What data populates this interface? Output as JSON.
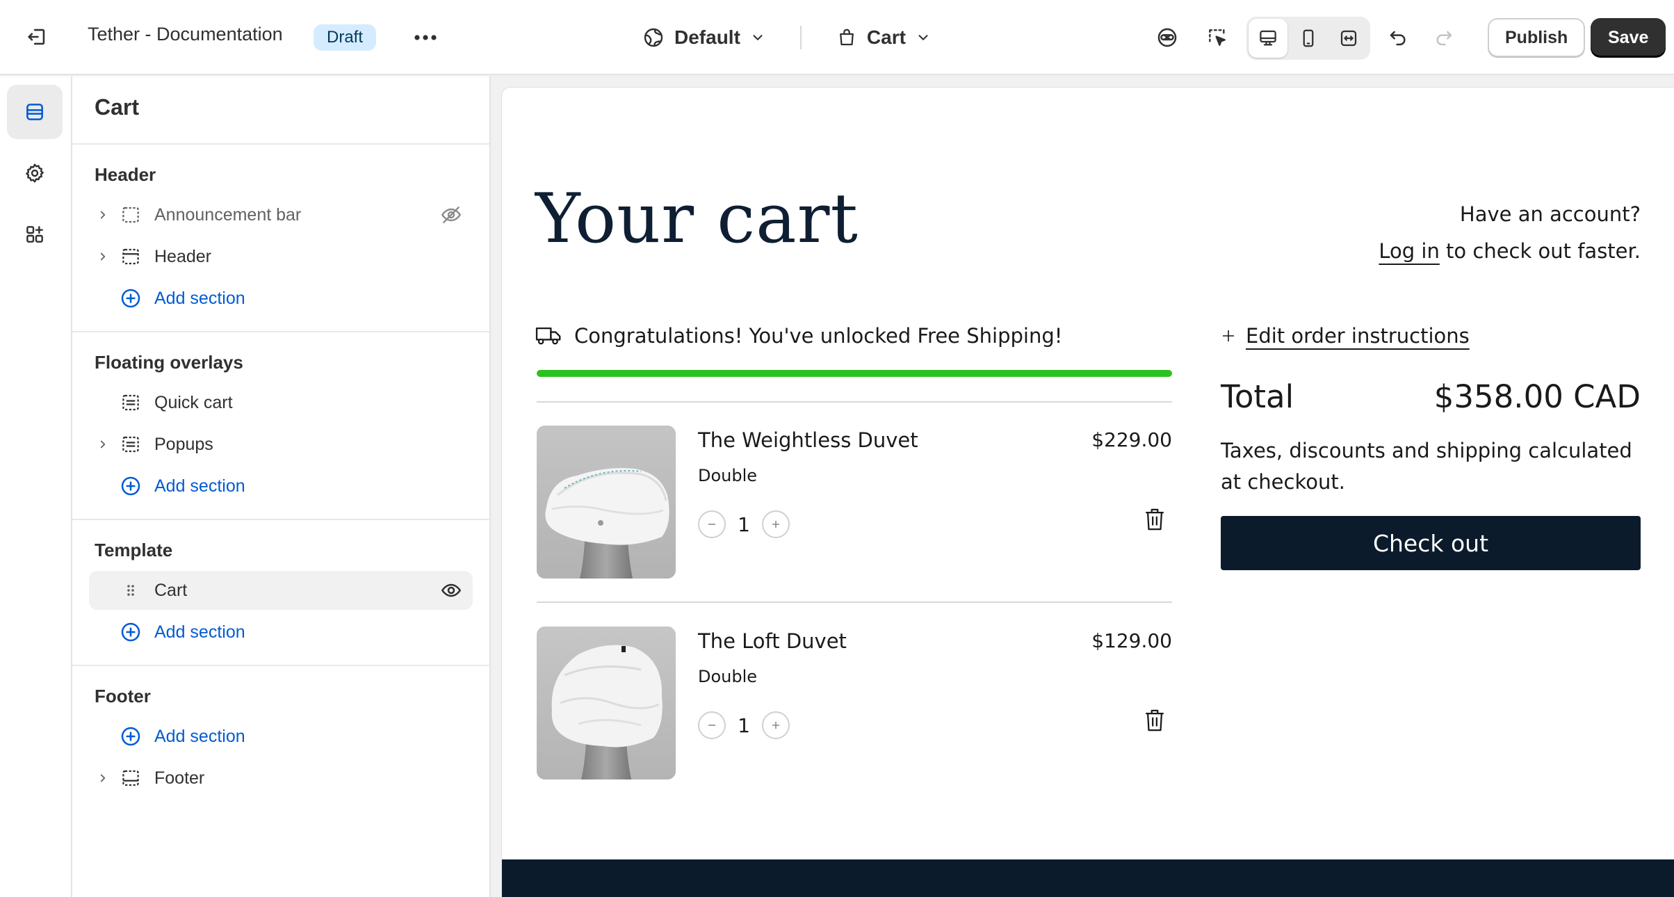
{
  "topbar": {
    "doc_title": "Tether - Documentation",
    "draft_badge": "Draft",
    "theme_dropdown": "Default",
    "page_dropdown": "Cart",
    "publish_label": "Publish",
    "save_label": "Save",
    "icons": [
      "exit-icon",
      "more-icon",
      "globe-icon",
      "chevron-down-icon",
      "bag-icon",
      "inspector-icon",
      "select-element-icon",
      "desktop-icon",
      "mobile-icon",
      "fullwidth-icon",
      "undo-icon",
      "redo-icon"
    ]
  },
  "rail": {
    "items": [
      "sections-icon",
      "settings-icon",
      "apps-icon"
    ],
    "active": "sections-icon"
  },
  "sidebar": {
    "title": "Cart",
    "groups": [
      {
        "heading": "Header",
        "rows": [
          {
            "label": "Announcement bar",
            "hidden": true
          },
          {
            "label": "Header"
          }
        ],
        "add_label": "Add section"
      },
      {
        "heading": "Floating overlays",
        "rows": [
          {
            "label": "Quick cart"
          },
          {
            "label": "Popups"
          }
        ],
        "add_label": "Add section"
      },
      {
        "heading": "Template",
        "rows": [
          {
            "label": "Cart",
            "selected": true
          }
        ],
        "add_label": "Add section"
      },
      {
        "heading": "Footer",
        "add_label": "Add section",
        "rows": [
          {
            "label": "Footer"
          }
        ]
      }
    ]
  },
  "preview": {
    "title": "Your cart",
    "account_question": "Have an account?",
    "login_link": "Log in",
    "login_suffix": " to check out faster.",
    "shipping_message": "Congratulations! You've unlocked Free Shipping!",
    "shipping_progress": 1.0,
    "items": [
      {
        "name": "The Weightless Duvet",
        "variant": "Double",
        "price": "$229.00",
        "quantity": "1"
      },
      {
        "name": "The Loft Duvet",
        "variant": "Double",
        "price": "$129.00",
        "quantity": "1"
      }
    ],
    "edit_instructions": "Edit order instructions",
    "total_label": "Total",
    "total_value": "$358.00 CAD",
    "tax_note": "Taxes, discounts and shipping calculated at checkout.",
    "checkout_label": "Check out"
  },
  "colors": {
    "accent_blue": "#005bd3",
    "shipping_green": "#2cc11f",
    "navy": "#0b1b2b",
    "draft_badge_bg": "#d5ebff"
  }
}
